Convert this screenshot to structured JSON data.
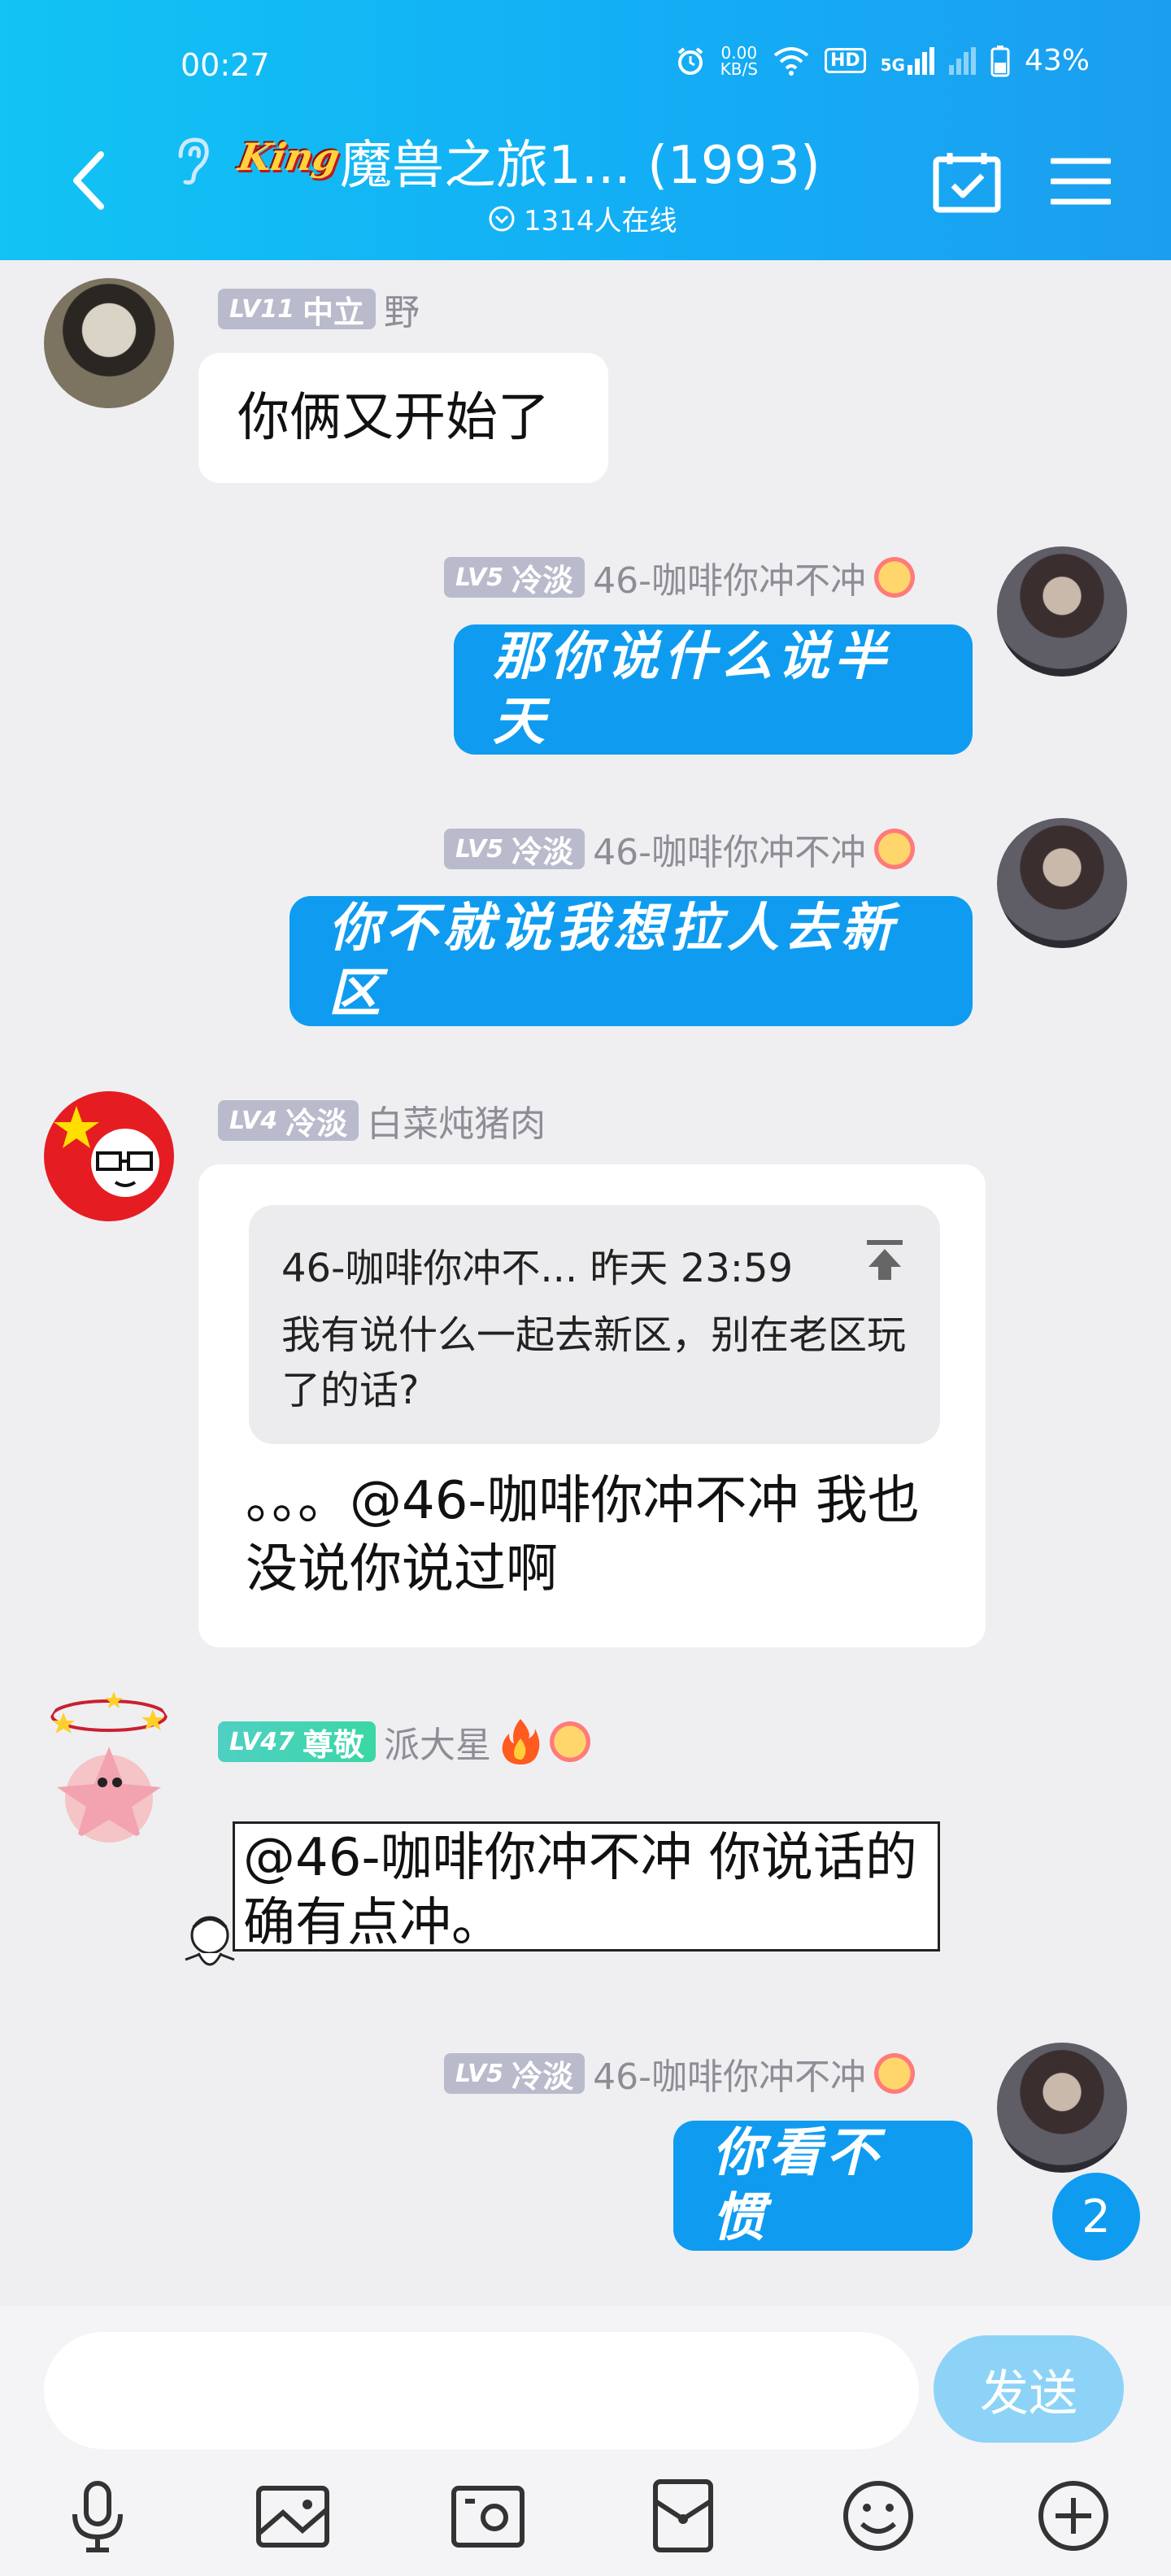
{
  "status": {
    "time": "00:27",
    "speed_top": "0.00",
    "speed_bottom": "KB/S",
    "hd": "HD",
    "net": "5G",
    "battery": "43%"
  },
  "header": {
    "logo": "King",
    "title": "魔兽之旅1... (1993)",
    "online": "1314人在线"
  },
  "messages": [
    {
      "level": "LV11",
      "title": "中立",
      "nick": "野",
      "text": "你俩又开始了"
    },
    {
      "level": "LV5",
      "title": "冷淡",
      "nick": "46-咖啡你冲不冲",
      "text": "那你说什么说半天"
    },
    {
      "level": "LV5",
      "title": "冷淡",
      "nick": "46-咖啡你冲不冲",
      "text": "你不就说我想拉人去新区"
    },
    {
      "level": "LV4",
      "title": "冷淡",
      "nick": "白菜炖猪肉",
      "quote_head": "46-咖啡你冲不... 昨天 23:59",
      "quote_text": "我有说什么一起去新区，别在老区玩了的话?",
      "text": "。。。@46-咖啡你冲不冲 我也没说你说过啊"
    },
    {
      "level": "LV47",
      "title": "尊敬",
      "nick": "派大星",
      "text": "@46-咖啡你冲不冲 你说话的确有点冲。"
    },
    {
      "level": "LV5",
      "title": "冷淡",
      "nick": "46-咖啡你冲不冲",
      "text": "你看不惯"
    }
  ],
  "unread_count": "2",
  "input": {
    "placeholder": "",
    "send_label": "发送"
  },
  "colors": {
    "accent": "#0f9cf0",
    "header": "#13aef5",
    "badge": "#b9bbcc"
  }
}
